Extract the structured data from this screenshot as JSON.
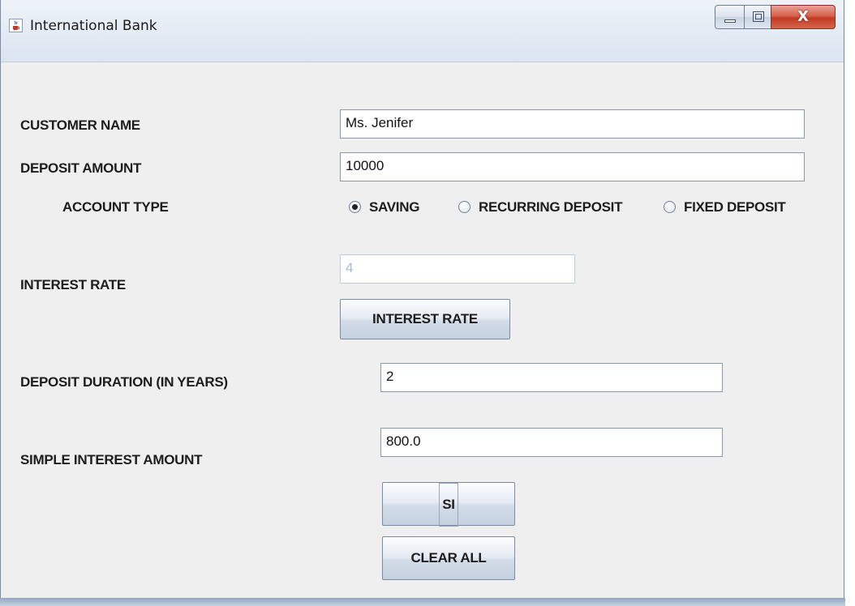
{
  "window": {
    "title": "International Bank",
    "close_glyph": "X"
  },
  "form": {
    "customer_name_label": "CUSTOMER NAME",
    "customer_name_value": "Ms. Jenifer",
    "deposit_amount_label": "DEPOSIT AMOUNT",
    "deposit_amount_value": "10000",
    "account_type_label": "ACCOUNT TYPE",
    "account_types": [
      {
        "label": "SAVING",
        "checked": true
      },
      {
        "label": "RECURRING DEPOSIT",
        "checked": false
      },
      {
        "label": "FIXED DEPOSIT",
        "checked": false
      }
    ],
    "interest_rate_label": "INTEREST RATE",
    "interest_rate_value": "4",
    "interest_rate_button": "INTEREST RATE",
    "duration_label": "DEPOSIT DURATION (IN YEARS)",
    "duration_value": "2",
    "si_amount_label": "SIMPLE INTEREST AMOUNT",
    "si_amount_value": "800.0",
    "si_button": "SI",
    "clear_button": "CLEAR ALL"
  },
  "icons": {
    "app": "java-cup-icon",
    "minimize": "minimize-icon",
    "maximize": "maximize-icon",
    "close": "close-icon"
  }
}
